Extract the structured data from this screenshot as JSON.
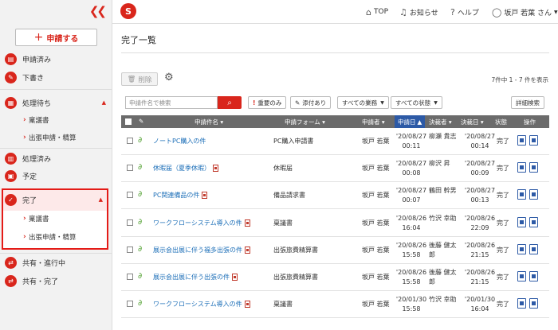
{
  "sidebar": {
    "collapse_icon": "double-chevron-left-icon",
    "apply_button": "申請する",
    "items": [
      {
        "label": "申請済み"
      },
      {
        "label": "下書き"
      },
      {
        "label": "処理待ち"
      },
      {
        "label": "処理済み"
      },
      {
        "label": "予定"
      },
      {
        "label": "完了"
      },
      {
        "label": "共有・進行中"
      },
      {
        "label": "共有・完了"
      }
    ],
    "pending_subitems": [
      "稟議書",
      "出張申請・精算"
    ],
    "done_subitems": [
      "稟議書",
      "出張申請・精算"
    ]
  },
  "header": {
    "logo": "S",
    "nav": {
      "top": "TOP",
      "notice": "お知らせ",
      "help": "ヘルプ",
      "user": "坂戸 若葉 さん"
    }
  },
  "main": {
    "title": "完了一覧",
    "delete_button": "削除",
    "count_text": "7件中 1 - 7 件を表示",
    "search_placeholder": "申請件名で検索",
    "filters": {
      "important": "重要のみ",
      "attached": "添付あり",
      "all_business": "すべての業務",
      "all_status": "すべての状態",
      "detail_search": "詳細検索"
    }
  },
  "table": {
    "headers": {
      "name": "申請件名",
      "form": "申請フォーム",
      "applicant": "申請者",
      "apply_date": "申請日",
      "approver": "決裁者",
      "approve_date": "決裁日",
      "status": "状態",
      "ops": "操作"
    },
    "rows": [
      {
        "name": "ノートPC購入の件",
        "form": "PC購入申請書",
        "applicant": "坂戸 若葉",
        "apply_date": "'20/08/27",
        "apply_time": "00:11",
        "approver": "柳瀬 貴志",
        "approve_date": "'20/08/27",
        "approve_time": "00:14",
        "status": "完了",
        "pdf": false
      },
      {
        "name": "休暇届（夏季休暇）",
        "form": "休暇届",
        "applicant": "坂戸 若葉",
        "apply_date": "'20/08/27",
        "apply_time": "00:08",
        "approver": "柳沢 昇",
        "approve_date": "'20/08/27",
        "approve_time": "00:09",
        "status": "完了",
        "pdf": true
      },
      {
        "name": "PC関連備品の件",
        "form": "備品請求書",
        "applicant": "坂戸 若葉",
        "apply_date": "'20/08/27",
        "apply_time": "00:07",
        "approver": "鶴田 幹男",
        "approve_date": "'20/08/27",
        "approve_time": "00:13",
        "status": "完了",
        "pdf": true
      },
      {
        "name": "ワークフローシステム導入の件",
        "form": "稟議書",
        "applicant": "坂戸 若葉",
        "apply_date": "'20/08/26",
        "apply_time": "16:04",
        "approver": "竹沢 幸助",
        "approve_date": "'20/08/26",
        "approve_time": "22:09",
        "status": "完了",
        "pdf": true
      },
      {
        "name": "展示会出展に伴う福多出張の件",
        "form": "出張旅費精算書",
        "applicant": "坂戸 若葉",
        "apply_date": "'20/08/26",
        "apply_time": "15:58",
        "approver": "後藤 健太郎",
        "approve_date": "'20/08/26",
        "approve_time": "21:15",
        "status": "完了",
        "pdf": true
      },
      {
        "name": "展示会出展に伴う出張の件",
        "form": "出張旅費精算書",
        "applicant": "坂戸 若葉",
        "apply_date": "'20/08/26",
        "apply_time": "15:58",
        "approver": "後藤 健太郎",
        "approve_date": "'20/08/26",
        "approve_time": "21:15",
        "status": "完了",
        "pdf": true
      },
      {
        "name": "ワークフローシステム導入の件",
        "form": "稟議書",
        "applicant": "坂戸 若葉",
        "apply_date": "'20/01/30",
        "apply_time": "15:58",
        "approver": "竹沢 幸助",
        "approve_date": "'20/01/30",
        "approve_time": "16:04",
        "status": "完了",
        "pdf": true
      }
    ]
  },
  "colors": {
    "accent": "#d9261c",
    "link": "#1d6fb8",
    "sorted_header": "#2d5aa6"
  }
}
